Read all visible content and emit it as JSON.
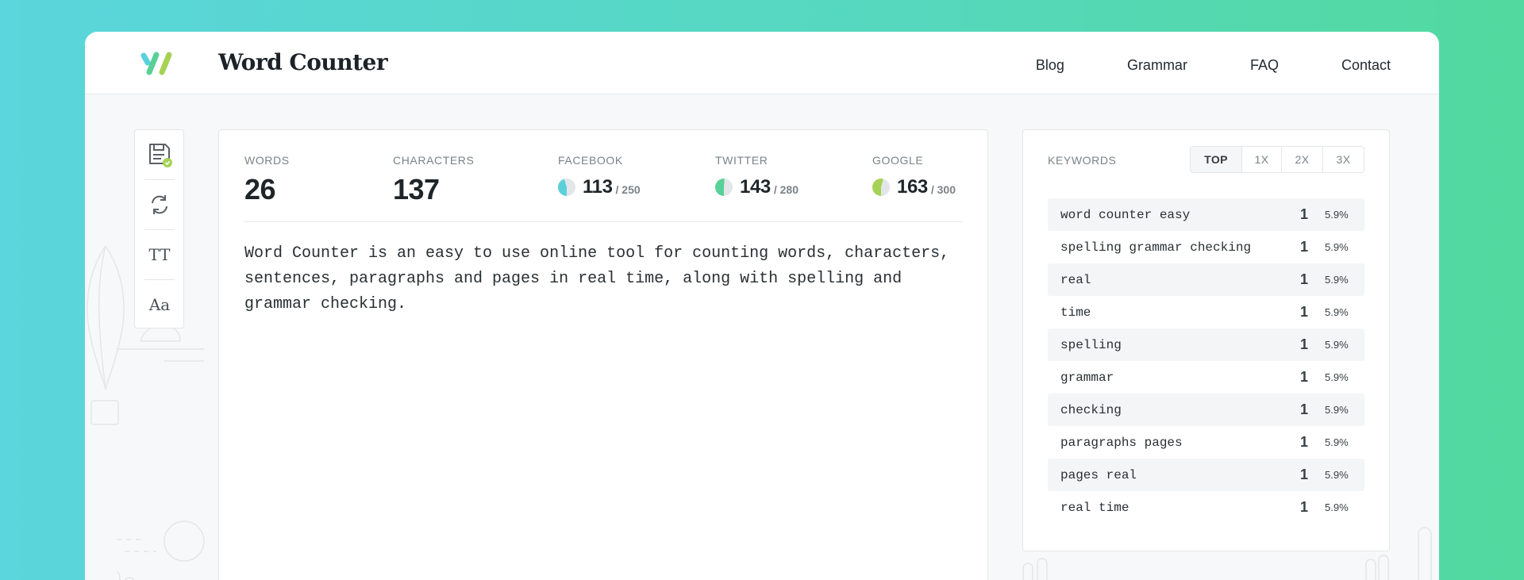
{
  "header": {
    "brand": "Word Counter",
    "nav": [
      "Blog",
      "Grammar",
      "FAQ",
      "Contact"
    ]
  },
  "toolbar": {
    "icons": [
      "save-icon",
      "sync-icon",
      "text-size-icon",
      "font-case-icon"
    ],
    "text_size_label": "TT",
    "font_case_label": "Aa"
  },
  "stats": {
    "words": {
      "label": "WORDS",
      "value": "26"
    },
    "characters": {
      "label": "CHARACTERS",
      "value": "137"
    },
    "facebook": {
      "label": "FACEBOOK",
      "value": "113",
      "limit": "/ 250",
      "fraction": 0.452,
      "color": "#5ad0db"
    },
    "twitter": {
      "label": "TWITTER",
      "value": "143",
      "limit": "/ 280",
      "fraction": 0.511,
      "color": "#57d197"
    },
    "google": {
      "label": "GOOGLE",
      "value": "163",
      "limit": "/ 300",
      "fraction": 0.543,
      "color": "#a6d256"
    }
  },
  "editor": {
    "text": "Word Counter is an easy to use online tool for counting words, characters, sentences, paragraphs and pages in real time, along with spelling and grammar checking."
  },
  "keywords": {
    "title": "KEYWORDS",
    "tabs": [
      "TOP",
      "1X",
      "2X",
      "3X"
    ],
    "rows": [
      {
        "word": "word counter easy",
        "count": "1",
        "pct": "5.9%"
      },
      {
        "word": "spelling grammar checking",
        "count": "1",
        "pct": "5.9%"
      },
      {
        "word": "real",
        "count": "1",
        "pct": "5.9%"
      },
      {
        "word": "time",
        "count": "1",
        "pct": "5.9%"
      },
      {
        "word": "spelling",
        "count": "1",
        "pct": "5.9%"
      },
      {
        "word": "grammar",
        "count": "1",
        "pct": "5.9%"
      },
      {
        "word": "checking",
        "count": "1",
        "pct": "5.9%"
      },
      {
        "word": "paragraphs pages",
        "count": "1",
        "pct": "5.9%"
      },
      {
        "word": "pages real",
        "count": "1",
        "pct": "5.9%"
      },
      {
        "word": "real time",
        "count": "1",
        "pct": "5.9%"
      }
    ]
  },
  "colors": {
    "accent_teal": "#5ad0db",
    "accent_green": "#a6d256"
  }
}
